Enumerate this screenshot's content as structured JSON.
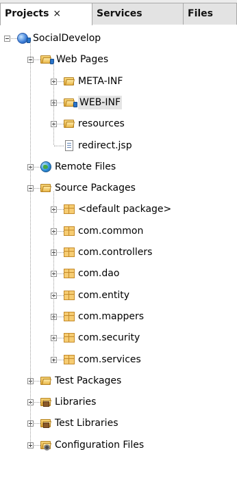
{
  "tabs": [
    {
      "label": "Projects",
      "close": "×",
      "active": true
    },
    {
      "label": "Services",
      "active": false
    },
    {
      "label": "Files",
      "active": false
    }
  ],
  "tree": [
    {
      "label": "SocialDevelop",
      "depth": 0,
      "toggle": "minus",
      "icon": "project-globe-icon",
      "badge": true
    },
    {
      "label": "Web Pages",
      "depth": 1,
      "toggle": "minus",
      "icon": "web-pages-folder-icon",
      "badge": true
    },
    {
      "label": "META-INF",
      "depth": 2,
      "toggle": "plus",
      "icon": "folder-icon"
    },
    {
      "label": "WEB-INF",
      "depth": 2,
      "toggle": "plus",
      "icon": "folder-icon",
      "badge": true,
      "selected": true
    },
    {
      "label": "resources",
      "depth": 2,
      "toggle": "plus",
      "icon": "folder-icon"
    },
    {
      "label": "redirect.jsp",
      "depth": 2,
      "toggle": "none",
      "icon": "jsp-file-icon"
    },
    {
      "label": "Remote Files",
      "depth": 1,
      "toggle": "plus",
      "icon": "remote-files-icon"
    },
    {
      "label": "Source Packages",
      "depth": 1,
      "toggle": "minus",
      "icon": "source-packages-icon"
    },
    {
      "label": "<default package>",
      "depth": 2,
      "toggle": "plus",
      "icon": "package-icon"
    },
    {
      "label": "com.common",
      "depth": 2,
      "toggle": "plus",
      "icon": "package-icon"
    },
    {
      "label": "com.controllers",
      "depth": 2,
      "toggle": "plus",
      "icon": "package-icon"
    },
    {
      "label": "com.dao",
      "depth": 2,
      "toggle": "plus",
      "icon": "package-icon"
    },
    {
      "label": "com.entity",
      "depth": 2,
      "toggle": "plus",
      "icon": "package-icon"
    },
    {
      "label": "com.mappers",
      "depth": 2,
      "toggle": "plus",
      "icon": "package-icon"
    },
    {
      "label": "com.security",
      "depth": 2,
      "toggle": "plus",
      "icon": "package-icon"
    },
    {
      "label": "com.services",
      "depth": 2,
      "toggle": "plus",
      "icon": "package-icon"
    },
    {
      "label": "Test Packages",
      "depth": 1,
      "toggle": "plus",
      "icon": "test-packages-icon"
    },
    {
      "label": "Libraries",
      "depth": 1,
      "toggle": "plus",
      "icon": "libraries-icon"
    },
    {
      "label": "Test Libraries",
      "depth": 1,
      "toggle": "plus",
      "icon": "test-libraries-icon"
    },
    {
      "label": "Configuration Files",
      "depth": 1,
      "toggle": "plus",
      "icon": "configuration-files-icon"
    }
  ]
}
